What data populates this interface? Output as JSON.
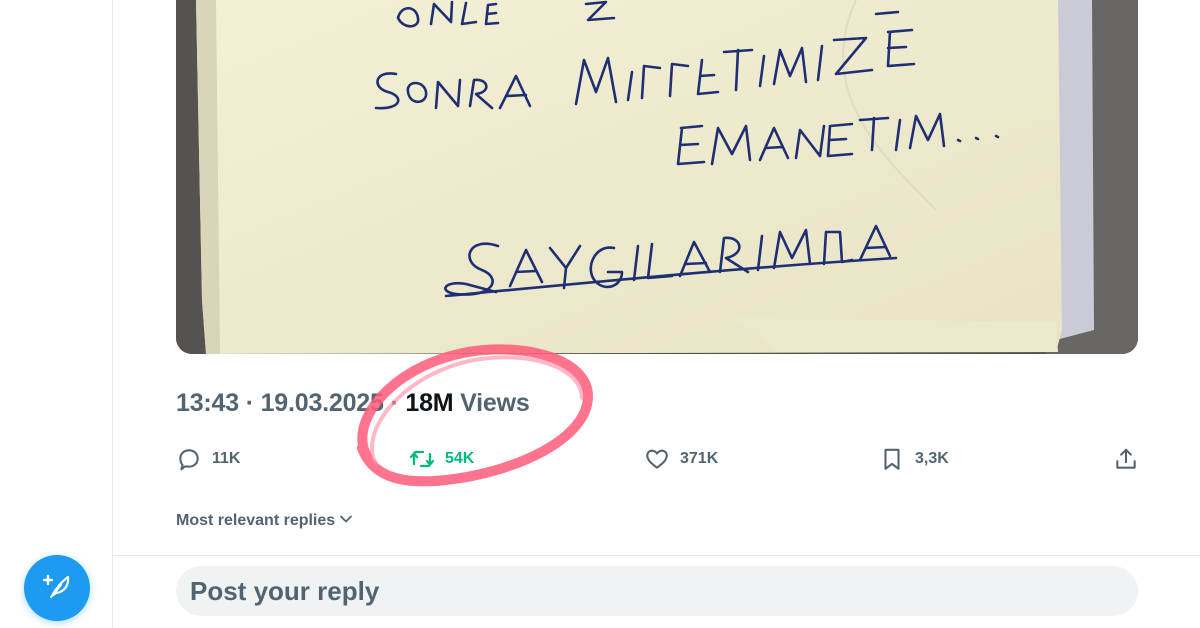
{
  "tweet": {
    "media": {
      "alt": "Handwritten note on yellowed paper",
      "note_lines": [
        "ÖNCE ALLAH",
        "SONRA MİLLETİMİZE",
        "EMANETİM...",
        "SAYGILARIMLA"
      ]
    },
    "time": "13:43",
    "separator": "·",
    "date": "19.03.2025",
    "views_count": "18M",
    "views_label": "Views",
    "highlight_color": "#ff5a7a"
  },
  "actions": {
    "reply": {
      "icon": "reply-icon",
      "count": "11K"
    },
    "retweet": {
      "icon": "retweet-icon",
      "count": "54K",
      "color": "#00ba7c"
    },
    "like": {
      "icon": "heart-icon",
      "count": "371K"
    },
    "bookmark": {
      "icon": "bookmark-icon",
      "count": "3,3K"
    },
    "share": {
      "icon": "share-icon"
    }
  },
  "replies": {
    "sort_label": "Most relevant replies",
    "sort_icon": "chevron-down-icon"
  },
  "composer": {
    "placeholder": "Post your reply",
    "fab_icon": "compose-feather-icon",
    "accent": "#1d9bf0"
  }
}
